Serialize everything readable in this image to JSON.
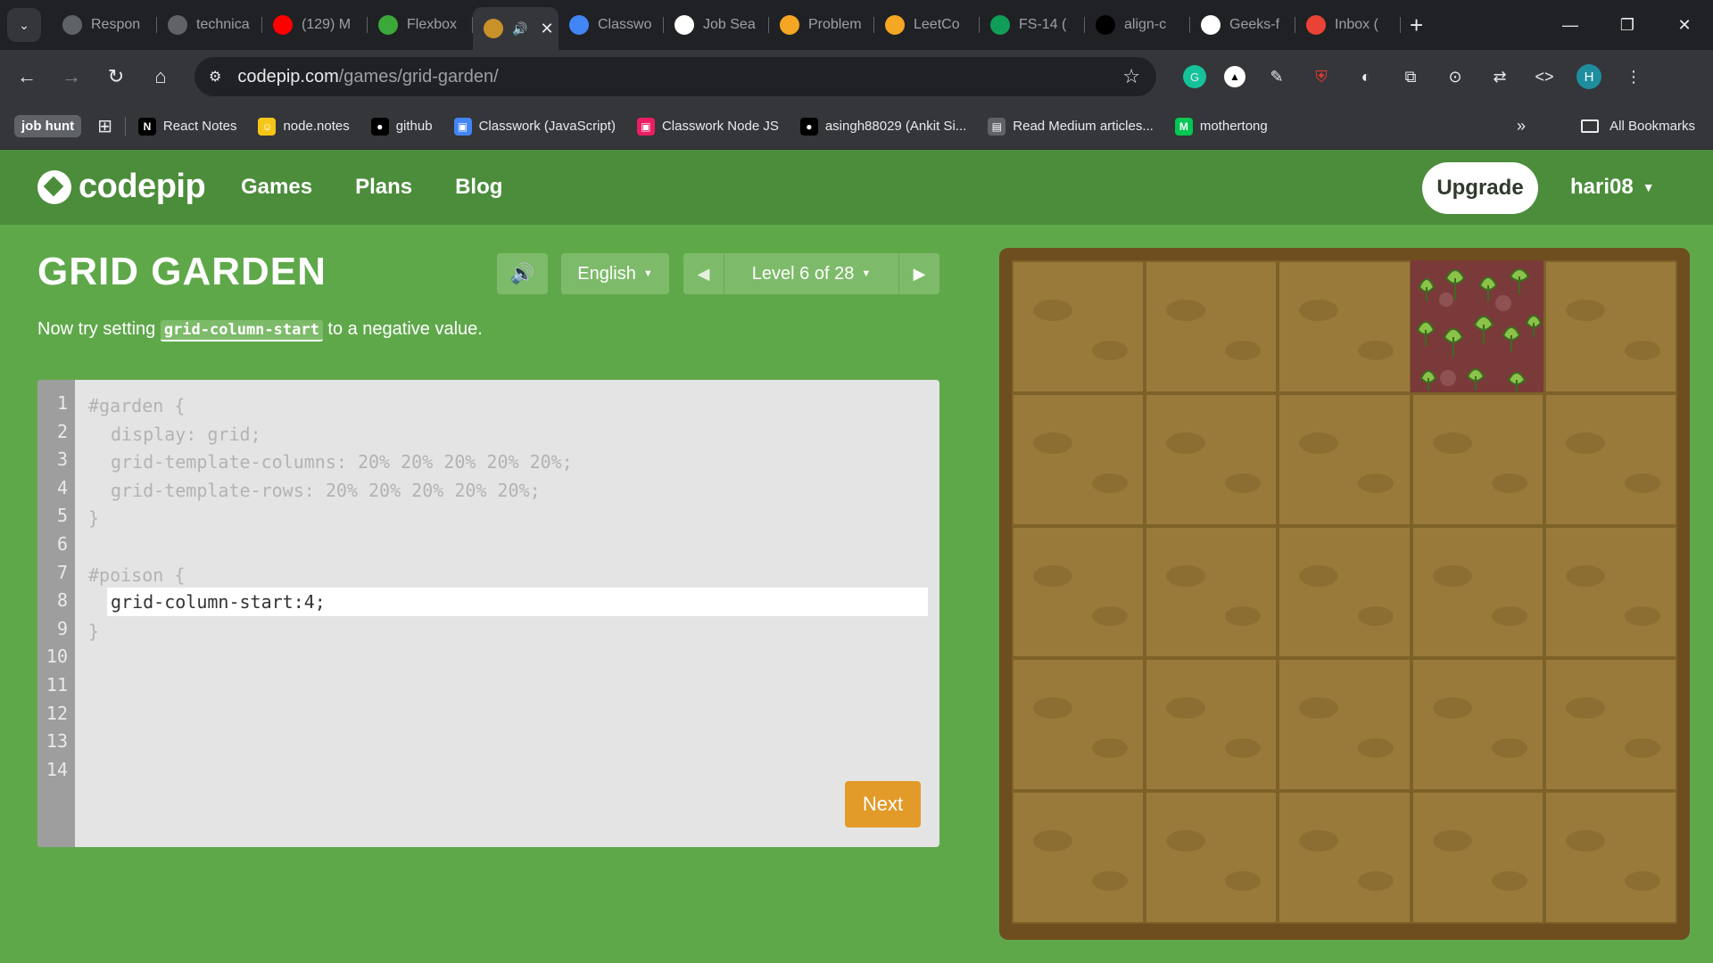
{
  "browser": {
    "tabs": [
      {
        "title": "Respon",
        "favicon": "#5f6368"
      },
      {
        "title": "technica",
        "favicon": "#5f6368"
      },
      {
        "title": "(129) M",
        "favicon": "#ff0000"
      },
      {
        "title": "Flexbox",
        "favicon": "#3ca83a"
      },
      {
        "title": "",
        "favicon": "#c8912a",
        "active": true
      },
      {
        "title": "Classwo",
        "favicon": "#4285f4"
      },
      {
        "title": "Job Sea",
        "favicon": "#ffffff"
      },
      {
        "title": "Problem",
        "favicon": "#f5a623"
      },
      {
        "title": "LeetCo",
        "favicon": "#f5a623"
      },
      {
        "title": "FS-14 (",
        "favicon": "#0f9d58"
      },
      {
        "title": "align-c",
        "favicon": "#000000"
      },
      {
        "title": "Geeks-f",
        "favicon": "#ffffff"
      },
      {
        "title": "Inbox (",
        "favicon": "#ea4335"
      }
    ],
    "url_domain": "codepip.com",
    "url_path": "/games/grid-garden/",
    "profile_initial": "H",
    "bookmarks_chip": "job hunt",
    "bookmarks": [
      {
        "label": "React Notes",
        "color": "#000000",
        "glyph": "N"
      },
      {
        "label": "node.notes",
        "color": "#f5c518",
        "glyph": "☺"
      },
      {
        "label": "github",
        "color": "#000000",
        "glyph": "●"
      },
      {
        "label": "Classwork (JavaScript)",
        "color": "#4285f4",
        "glyph": "▣"
      },
      {
        "label": "Classwork Node JS",
        "color": "#e91e63",
        "glyph": "▣"
      },
      {
        "label": "asingh88029 (Ankit Si...",
        "color": "#000000",
        "glyph": "●"
      },
      {
        "label": "Read Medium articles...",
        "color": "#5f6368",
        "glyph": "▤"
      },
      {
        "label": "mothertong",
        "color": "#00c853",
        "glyph": "M"
      }
    ],
    "all_bookmarks": "All Bookmarks"
  },
  "site": {
    "logo": "codepip",
    "nav": [
      "Games",
      "Plans",
      "Blog"
    ],
    "upgrade": "Upgrade",
    "user": "hari08"
  },
  "game": {
    "title": "GRID GARDEN",
    "language": "English",
    "level": "Level 6 of 28",
    "instruction_before": "Now try setting ",
    "instruction_code": "grid-column-start",
    "instruction_after": " to a negative value.",
    "code_lines": [
      "#garden {",
      "display: grid;",
      "grid-template-columns: 20% 20% 20% 20% 20%;",
      "grid-template-rows: 20% 20% 20% 20% 20%;",
      "}",
      "",
      "#poison {",
      "",
      "}"
    ],
    "line_numbers": [
      "1",
      "2",
      "3",
      "4",
      "5",
      "6",
      "7",
      "8",
      "9",
      "10",
      "11",
      "12",
      "13",
      "14"
    ],
    "input_value": "grid-column-start:4;",
    "next": "Next"
  },
  "colors": {
    "header": "#4c8d3c",
    "page": "#5fa84a",
    "soil": "#9a7a3b",
    "poison": "#7a3a3a",
    "next_button": "#e29a28"
  }
}
